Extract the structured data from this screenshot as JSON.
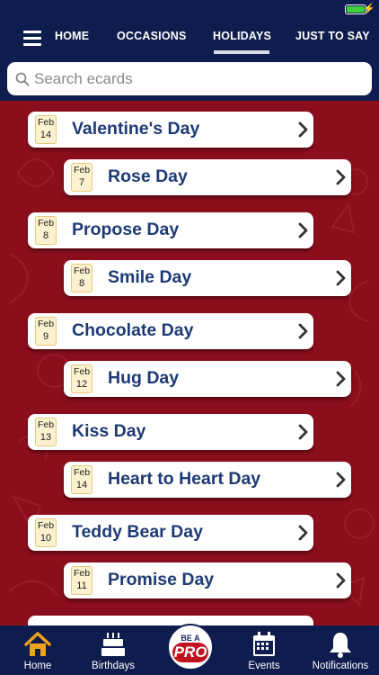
{
  "status": {
    "battery_level": 1.0
  },
  "nav": {
    "tabs": [
      {
        "label": "HOME"
      },
      {
        "label": "OCCASIONS"
      },
      {
        "label": "HOLIDAYS",
        "active": true
      },
      {
        "label": "JUST TO SAY"
      }
    ]
  },
  "search": {
    "placeholder": "Search ecards",
    "value": ""
  },
  "items": [
    {
      "label": "Valentine's Day",
      "month": "Feb",
      "day": "14"
    },
    {
      "label": "Rose Day",
      "month": "Feb",
      "day": "7"
    },
    {
      "label": "Propose Day",
      "month": "Feb",
      "day": "8"
    },
    {
      "label": "Smile Day",
      "month": "Feb",
      "day": "8"
    },
    {
      "label": "Chocolate Day",
      "month": "Feb",
      "day": "9"
    },
    {
      "label": "Hug Day",
      "month": "Feb",
      "day": "12"
    },
    {
      "label": "Kiss Day",
      "month": "Feb",
      "day": "13"
    },
    {
      "label": "Heart to Heart Day",
      "month": "Feb",
      "day": "14"
    },
    {
      "label": "Teddy Bear Day",
      "month": "Feb",
      "day": "10"
    },
    {
      "label": "Promise Day",
      "month": "Feb",
      "day": "11"
    }
  ],
  "tabbar": {
    "home": "Home",
    "birthdays": "Birthdays",
    "pro_top": "BE A",
    "pro_bottom": "PRO",
    "events": "Events",
    "notifications": "Notifications"
  },
  "colors": {
    "navy": "#0f1d4e",
    "background_red": "#8b0e1c",
    "label_blue": "#1e3a76",
    "pro_red": "#c0121f",
    "home_icon_gold": "#f0a21a"
  },
  "icons": [
    "hamburger-menu-icon",
    "search-icon",
    "chevron-right-icon",
    "home-icon",
    "birthday-cake-icon",
    "calendar-icon",
    "bell-icon"
  ]
}
